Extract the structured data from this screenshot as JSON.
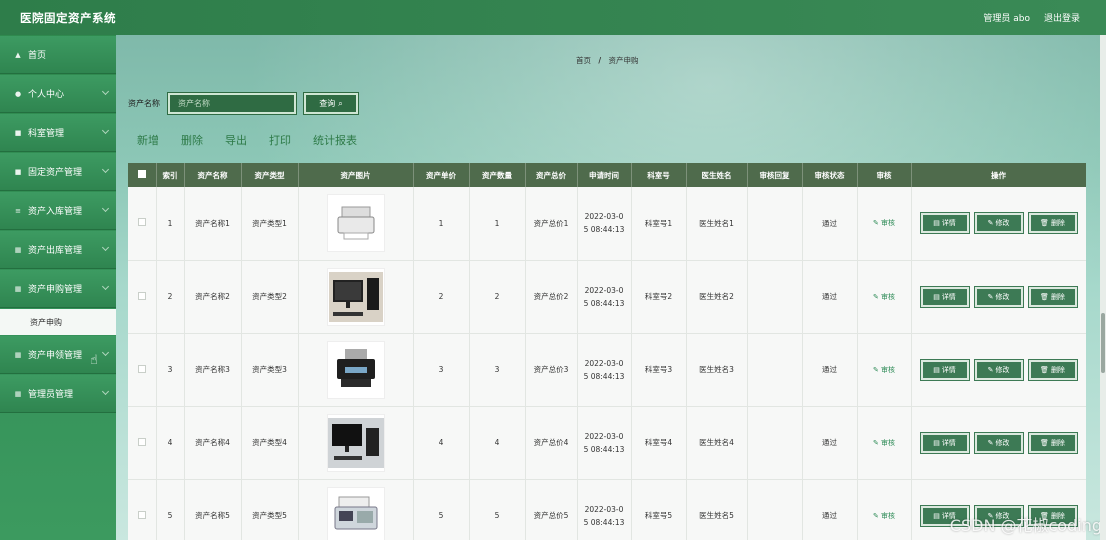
{
  "header": {
    "brand": "医院固定资产系统",
    "user": "管理员 abo",
    "logout": "退出登录"
  },
  "sidebar": {
    "items": [
      {
        "label": "首页",
        "icon": "home-icon"
      },
      {
        "label": "个人中心",
        "icon": "user-icon"
      },
      {
        "label": "科室管理",
        "icon": "list-icon"
      },
      {
        "label": "固定资产管理",
        "icon": "grid-icon"
      },
      {
        "label": "资产入库管理",
        "icon": "menu-icon"
      },
      {
        "label": "资产出库管理",
        "icon": "grid-icon"
      },
      {
        "label": "资产申购管理",
        "icon": "grid-icon"
      },
      {
        "label": "资产申领管理",
        "icon": "grid-icon"
      },
      {
        "label": "管理员管理",
        "icon": "grid-icon"
      }
    ],
    "submenu": "资产申购"
  },
  "breadcrumb": {
    "home": "首页",
    "sep": "/",
    "current": "资产申购"
  },
  "search": {
    "label": "资产名称",
    "placeholder": "资产名称",
    "button": "查询"
  },
  "toolbar": {
    "add": "新增",
    "delete": "删除",
    "export": "导出",
    "print": "打印",
    "report": "统计报表"
  },
  "table": {
    "headers": [
      "索引",
      "资产名称",
      "资产类型",
      "资产图片",
      "资产单价",
      "资产数量",
      "资产总价",
      "申请时间",
      "科室号",
      "医生姓名",
      "审核回复",
      "审核状态",
      "审核",
      "操作"
    ],
    "rows": [
      {
        "index": "1",
        "name": "资产名称1",
        "type": "资产类型1",
        "price": "1",
        "qty": "1",
        "total": "资产总价1",
        "time1": "2022-03-0",
        "time2": "5 08:44:13",
        "dept": "科室号1",
        "doctor": "医生姓名1",
        "reply": "",
        "status": "通过",
        "audit": "审核",
        "image": "printer-image"
      },
      {
        "index": "2",
        "name": "资产名称2",
        "type": "资产类型2",
        "price": "2",
        "qty": "2",
        "total": "资产总价2",
        "time1": "2022-03-0",
        "time2": "5 08:44:13",
        "dept": "科室号2",
        "doctor": "医生姓名2",
        "reply": "",
        "status": "通过",
        "audit": "审核",
        "image": "computer-image"
      },
      {
        "index": "3",
        "name": "资产名称3",
        "type": "资产类型3",
        "price": "3",
        "qty": "3",
        "total": "资产总价3",
        "time1": "2022-03-0",
        "time2": "5 08:44:13",
        "dept": "科室号3",
        "doctor": "医生姓名3",
        "reply": "",
        "status": "通过",
        "audit": "审核",
        "image": "inkjet-printer-image"
      },
      {
        "index": "4",
        "name": "资产名称4",
        "type": "资产类型4",
        "price": "4",
        "qty": "4",
        "total": "资产总价4",
        "time1": "2022-03-0",
        "time2": "5 08:44:13",
        "dept": "科室号4",
        "doctor": "医生姓名4",
        "reply": "",
        "status": "通过",
        "audit": "审核",
        "image": "desktop-image"
      },
      {
        "index": "5",
        "name": "资产名称5",
        "type": "资产类型5",
        "price": "5",
        "qty": "5",
        "total": "资产总价5",
        "time1": "2022-03-0",
        "time2": "5 08:44:13",
        "dept": "科室号5",
        "doctor": "医生姓名5",
        "reply": "",
        "status": "通过",
        "audit": "审核",
        "image": "fax-image"
      }
    ],
    "ops": {
      "detail": "详情",
      "edit": "修改",
      "delete": "删除"
    }
  },
  "watermark": "CSDN @花椒coding",
  "colors": {
    "topbar": "#2e7d4a",
    "sidebar": "#35925a",
    "table_header": "#4f6b4c",
    "button": "#3d7a55"
  }
}
